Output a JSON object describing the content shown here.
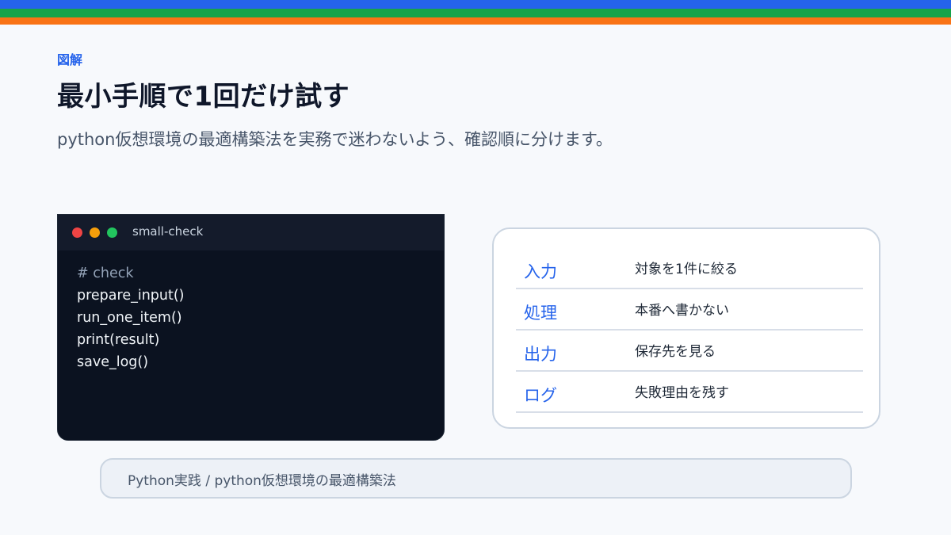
{
  "eyebrow": "図解",
  "title": "最小手順で1回だけ試す",
  "subtitle": "python仮想環境の最適構築法を実務で迷わないよう、確認順に分けます。",
  "terminal": {
    "title": "small-check",
    "lines": [
      "# check",
      "prepare_input()",
      "run_one_item()",
      "print(result)",
      "save_log()"
    ]
  },
  "steps": [
    {
      "key": "入力",
      "value": "対象を1件に絞る"
    },
    {
      "key": "処理",
      "value": "本番へ書かない"
    },
    {
      "key": "出力",
      "value": "保存先を見る"
    },
    {
      "key": "ログ",
      "value": "失敗理由を残す"
    }
  ],
  "footer": "Python実践 / python仮想環境の最適構築法",
  "colors": {
    "accent_blue": "#2563eb",
    "stripe_green": "#16a34a",
    "stripe_orange": "#f97316",
    "terminal_bg": "#0b1220"
  }
}
